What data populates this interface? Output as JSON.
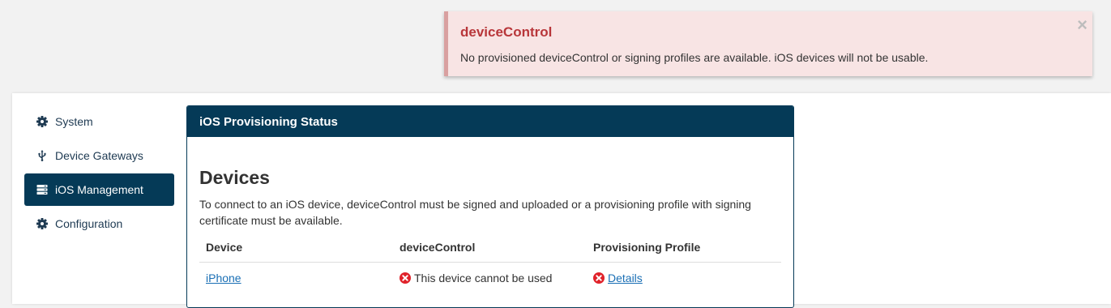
{
  "alert": {
    "title": "deviceControl",
    "message": "No provisioned deviceControl or signing profiles are available. iOS devices will not be usable.",
    "close_glyph": "×",
    "colors": {
      "background": "#f8e4e4",
      "title": "#b8363a",
      "border": "#d9a0a0"
    }
  },
  "sidebar": {
    "items": [
      {
        "label": "System",
        "icon": "gear-icon",
        "active": false
      },
      {
        "label": "Device Gateways",
        "icon": "usb-icon",
        "active": false
      },
      {
        "label": "iOS Management",
        "icon": "server-icon",
        "active": true
      },
      {
        "label": "Configuration",
        "icon": "gear-icon",
        "active": false
      }
    ]
  },
  "card": {
    "header": "iOS Provisioning Status",
    "heading": "Devices",
    "description": "To connect to an iOS device, deviceControl must be signed and uploaded or a provisioning profile with signing certificate must be available.",
    "table": {
      "columns": [
        "Device",
        "deviceControl",
        "Provisioning Profile"
      ],
      "rows": [
        {
          "device": "iPhone",
          "device_control_status": "This device cannot be used",
          "device_control_icon": "error-icon",
          "provisioning_profile": "Details",
          "provisioning_profile_icon": "error-icon"
        }
      ]
    }
  },
  "colors": {
    "accent": "#053a57",
    "link": "#1a6fb5",
    "error": "#e0222a"
  }
}
